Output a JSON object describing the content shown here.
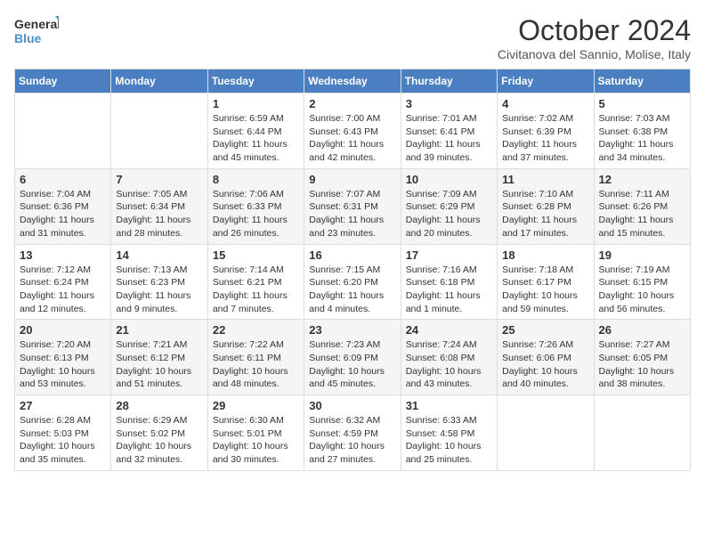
{
  "logo": {
    "general": "General",
    "blue": "Blue"
  },
  "title": "October 2024",
  "subtitle": "Civitanova del Sannio, Molise, Italy",
  "days_header": [
    "Sunday",
    "Monday",
    "Tuesday",
    "Wednesday",
    "Thursday",
    "Friday",
    "Saturday"
  ],
  "weeks": [
    [
      {
        "day": "",
        "info": ""
      },
      {
        "day": "",
        "info": ""
      },
      {
        "day": "1",
        "info": "Sunrise: 6:59 AM\nSunset: 6:44 PM\nDaylight: 11 hours and 45 minutes."
      },
      {
        "day": "2",
        "info": "Sunrise: 7:00 AM\nSunset: 6:43 PM\nDaylight: 11 hours and 42 minutes."
      },
      {
        "day": "3",
        "info": "Sunrise: 7:01 AM\nSunset: 6:41 PM\nDaylight: 11 hours and 39 minutes."
      },
      {
        "day": "4",
        "info": "Sunrise: 7:02 AM\nSunset: 6:39 PM\nDaylight: 11 hours and 37 minutes."
      },
      {
        "day": "5",
        "info": "Sunrise: 7:03 AM\nSunset: 6:38 PM\nDaylight: 11 hours and 34 minutes."
      }
    ],
    [
      {
        "day": "6",
        "info": "Sunrise: 7:04 AM\nSunset: 6:36 PM\nDaylight: 11 hours and 31 minutes."
      },
      {
        "day": "7",
        "info": "Sunrise: 7:05 AM\nSunset: 6:34 PM\nDaylight: 11 hours and 28 minutes."
      },
      {
        "day": "8",
        "info": "Sunrise: 7:06 AM\nSunset: 6:33 PM\nDaylight: 11 hours and 26 minutes."
      },
      {
        "day": "9",
        "info": "Sunrise: 7:07 AM\nSunset: 6:31 PM\nDaylight: 11 hours and 23 minutes."
      },
      {
        "day": "10",
        "info": "Sunrise: 7:09 AM\nSunset: 6:29 PM\nDaylight: 11 hours and 20 minutes."
      },
      {
        "day": "11",
        "info": "Sunrise: 7:10 AM\nSunset: 6:28 PM\nDaylight: 11 hours and 17 minutes."
      },
      {
        "day": "12",
        "info": "Sunrise: 7:11 AM\nSunset: 6:26 PM\nDaylight: 11 hours and 15 minutes."
      }
    ],
    [
      {
        "day": "13",
        "info": "Sunrise: 7:12 AM\nSunset: 6:24 PM\nDaylight: 11 hours and 12 minutes."
      },
      {
        "day": "14",
        "info": "Sunrise: 7:13 AM\nSunset: 6:23 PM\nDaylight: 11 hours and 9 minutes."
      },
      {
        "day": "15",
        "info": "Sunrise: 7:14 AM\nSunset: 6:21 PM\nDaylight: 11 hours and 7 minutes."
      },
      {
        "day": "16",
        "info": "Sunrise: 7:15 AM\nSunset: 6:20 PM\nDaylight: 11 hours and 4 minutes."
      },
      {
        "day": "17",
        "info": "Sunrise: 7:16 AM\nSunset: 6:18 PM\nDaylight: 11 hours and 1 minute."
      },
      {
        "day": "18",
        "info": "Sunrise: 7:18 AM\nSunset: 6:17 PM\nDaylight: 10 hours and 59 minutes."
      },
      {
        "day": "19",
        "info": "Sunrise: 7:19 AM\nSunset: 6:15 PM\nDaylight: 10 hours and 56 minutes."
      }
    ],
    [
      {
        "day": "20",
        "info": "Sunrise: 7:20 AM\nSunset: 6:13 PM\nDaylight: 10 hours and 53 minutes."
      },
      {
        "day": "21",
        "info": "Sunrise: 7:21 AM\nSunset: 6:12 PM\nDaylight: 10 hours and 51 minutes."
      },
      {
        "day": "22",
        "info": "Sunrise: 7:22 AM\nSunset: 6:11 PM\nDaylight: 10 hours and 48 minutes."
      },
      {
        "day": "23",
        "info": "Sunrise: 7:23 AM\nSunset: 6:09 PM\nDaylight: 10 hours and 45 minutes."
      },
      {
        "day": "24",
        "info": "Sunrise: 7:24 AM\nSunset: 6:08 PM\nDaylight: 10 hours and 43 minutes."
      },
      {
        "day": "25",
        "info": "Sunrise: 7:26 AM\nSunset: 6:06 PM\nDaylight: 10 hours and 40 minutes."
      },
      {
        "day": "26",
        "info": "Sunrise: 7:27 AM\nSunset: 6:05 PM\nDaylight: 10 hours and 38 minutes."
      }
    ],
    [
      {
        "day": "27",
        "info": "Sunrise: 6:28 AM\nSunset: 5:03 PM\nDaylight: 10 hours and 35 minutes."
      },
      {
        "day": "28",
        "info": "Sunrise: 6:29 AM\nSunset: 5:02 PM\nDaylight: 10 hours and 32 minutes."
      },
      {
        "day": "29",
        "info": "Sunrise: 6:30 AM\nSunset: 5:01 PM\nDaylight: 10 hours and 30 minutes."
      },
      {
        "day": "30",
        "info": "Sunrise: 6:32 AM\nSunset: 4:59 PM\nDaylight: 10 hours and 27 minutes."
      },
      {
        "day": "31",
        "info": "Sunrise: 6:33 AM\nSunset: 4:58 PM\nDaylight: 10 hours and 25 minutes."
      },
      {
        "day": "",
        "info": ""
      },
      {
        "day": "",
        "info": ""
      }
    ]
  ]
}
